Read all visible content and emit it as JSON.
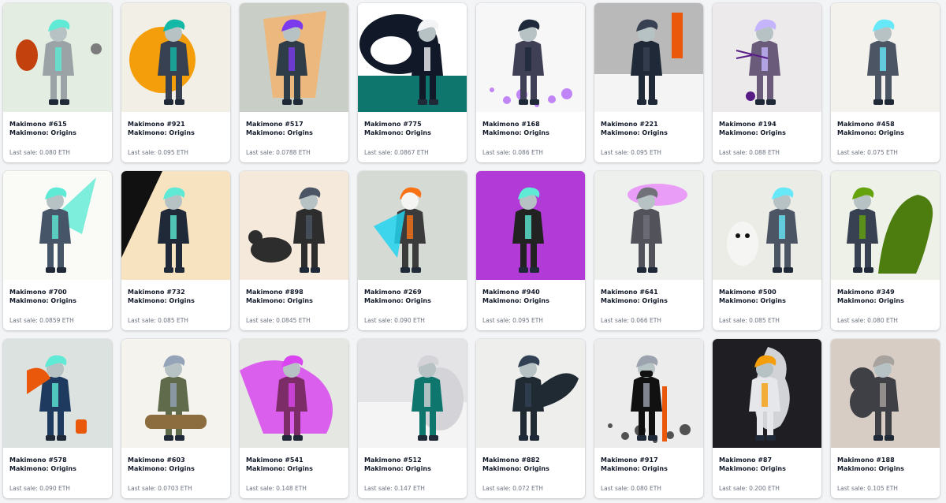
{
  "page": {
    "sale_prefix": "Last sale: "
  },
  "cards": [
    {
      "name": "Makimono #615",
      "collection": "Makimono: Origins",
      "price": "0.080 ETH",
      "bg": "#e4ede2",
      "c1": "#9ca3a6",
      "c2": "#c2410c",
      "c3": "#5eead4",
      "motif": "bird"
    },
    {
      "name": "Makimono #921",
      "collection": "Makimono: Origins",
      "price": "0.095 ETH",
      "bg": "#f2f0e6",
      "c1": "#374151",
      "c2": "#f59e0b",
      "c3": "#14b8a6",
      "motif": "orange-sun"
    },
    {
      "name": "Makimono #517",
      "collection": "Makimono: Origins",
      "price": "0.0788 ETH",
      "bg": "#c9cfc6",
      "c1": "#2f3d48",
      "c2": "#f5b26b",
      "c3": "#7c3aed",
      "motif": "tall"
    },
    {
      "name": "Makimono #775",
      "collection": "Makimono: Origins",
      "price": "0.0867 ETH",
      "bg": "#ffffff",
      "c1": "#111827",
      "c2": "#0f766e",
      "c3": "#f3f4f6",
      "motif": "orca"
    },
    {
      "name": "Makimono #168",
      "collection": "Makimono: Origins",
      "price": "0.086 ETH",
      "bg": "#f7f7f7",
      "c1": "#3f3f56",
      "c2": "#a855f7",
      "c3": "#1e293b",
      "motif": "splash"
    },
    {
      "name": "Makimono #221",
      "collection": "Makimono: Origins",
      "price": "0.095 ETH",
      "bg": "#c7c7c7",
      "c1": "#1f2937",
      "c2": "#ea580c",
      "c3": "#374151",
      "motif": "hood"
    },
    {
      "name": "Makimono #194",
      "collection": "Makimono: Origins",
      "price": "0.088 ETH",
      "bg": "#eceaea",
      "c1": "#6b5b7b",
      "c2": "#581c87",
      "c3": "#c4b5fd",
      "motif": "spider"
    },
    {
      "name": "Makimono #458",
      "collection": "Makimono: Origins",
      "price": "0.075 ETH",
      "bg": "#f4f2ec",
      "c1": "#4b5563",
      "c2": "#d97706",
      "c3": "#67e8f9",
      "motif": "coat"
    },
    {
      "name": "Makimono #700",
      "collection": "Makimono: Origins",
      "price": "0.0859 ETH",
      "bg": "#fafaf7",
      "c1": "#475569",
      "c2": "#7c3aed",
      "c3": "#5eead4",
      "motif": "lizard"
    },
    {
      "name": "Makimono #732",
      "collection": "Makimono: Origins",
      "price": "0.085 ETH",
      "bg": "#f7e3c0",
      "c1": "#1f2937",
      "c2": "#111111",
      "c3": "#5eead4",
      "motif": "dark-split"
    },
    {
      "name": "Makimono #898",
      "collection": "Makimono: Origins",
      "price": "0.0845 ETH",
      "bg": "#f5e9dc",
      "c1": "#2d2d2d",
      "c2": "#d97706",
      "c3": "#4b5563",
      "motif": "dog"
    },
    {
      "name": "Makimono #269",
      "collection": "Makimono: Origins",
      "price": "0.090 ETH",
      "bg": "#d5dad4",
      "c1": "#3b3b3b",
      "c2": "#22d3ee",
      "c3": "#f97316",
      "motif": "skull"
    },
    {
      "name": "Makimono #940",
      "collection": "Makimono: Origins",
      "price": "0.095 ETH",
      "bg": "#b23ad6",
      "c1": "#222222",
      "c2": "#7c3aed",
      "c3": "#5eead4",
      "motif": "purple"
    },
    {
      "name": "Makimono #641",
      "collection": "Makimono: Origins",
      "price": "0.066 ETH",
      "bg": "#eef0ed",
      "c1": "#52525b",
      "c2": "#e879f9",
      "c3": "#71717a",
      "motif": "tree"
    },
    {
      "name": "Makimono #500",
      "collection": "Makimono: Origins",
      "price": "0.085 ETH",
      "bg": "#ecece6",
      "c1": "#4b5563",
      "c2": "#f5f5f4",
      "c3": "#67e8f9",
      "motif": "owl"
    },
    {
      "name": "Makimono #349",
      "collection": "Makimono: Origins",
      "price": "0.080 ETH",
      "bg": "#eef1e8",
      "c1": "#374151",
      "c2": "#4d7c0f",
      "c3": "#65a30d",
      "motif": "dino"
    },
    {
      "name": "Makimono #578",
      "collection": "Makimono: Origins",
      "price": "0.090 ETH",
      "bg": "#dce2df",
      "c1": "#1e3a5f",
      "c2": "#ea580c",
      "c3": "#5eead4",
      "motif": "lantern"
    },
    {
      "name": "Makimono #603",
      "collection": "Makimono: Origins",
      "price": "0.0703 ETH",
      "bg": "#f5f3ee",
      "c1": "#5f6b4a",
      "c2": "#8b6d3f",
      "c3": "#94a3b8",
      "motif": "sit"
    },
    {
      "name": "Makimono #541",
      "collection": "Makimono: Origins",
      "price": "0.148 ETH",
      "bg": "#e5e7e2",
      "c1": "#7c2d67",
      "c2": "#e11d48",
      "c3": "#d946ef",
      "motif": "dragon"
    },
    {
      "name": "Makimono #512",
      "collection": "Makimono: Origins",
      "price": "0.147 ETH",
      "bg": "#f4f4f4",
      "c1": "#0f766e",
      "c2": "#d97706",
      "c3": "#d4d4d8",
      "motif": "yeti"
    },
    {
      "name": "Makimono #882",
      "collection": "Makimono: Origins",
      "price": "0.072 ETH",
      "bg": "#eeeeed",
      "c1": "#1f2a33",
      "c2": "#f4a88a",
      "c3": "#334155",
      "motif": "wings"
    },
    {
      "name": "Makimono #917",
      "collection": "Makimono: Origins",
      "price": "0.080 ETH",
      "bg": "#ececec",
      "c1": "#111111",
      "c2": "#ea580c",
      "c3": "#9ca3af",
      "motif": "mask"
    },
    {
      "name": "Makimono #87",
      "collection": "Makimono: Origins",
      "price": "0.200 ETH",
      "bg": "#1f1f23",
      "c1": "#e5e7eb",
      "c2": "#22d3ee",
      "c3": "#f59e0b",
      "motif": "ghost"
    },
    {
      "name": "Makimono #188",
      "collection": "Makimono: Origins",
      "price": "0.105 ETH",
      "bg": "#d8cdc5",
      "c1": "#3f3f46",
      "c2": "#0891b2",
      "c3": "#a8a29e",
      "motif": "monkey"
    }
  ]
}
